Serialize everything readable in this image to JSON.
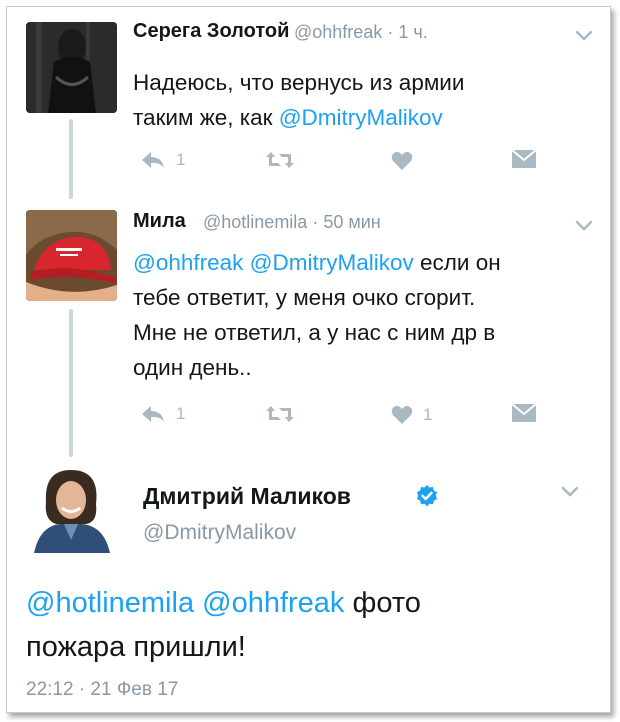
{
  "thread": [
    {
      "author_name": "Серега Золотой",
      "handle": "@ohhfreak",
      "separator": "·",
      "time": "1 ч.",
      "text_line1": "Надеюсь, что вернусь из армии",
      "text_line2_prefix": "таким же, как ",
      "text_line2_mention": "@DmitryMalikov",
      "reply_count": "1",
      "like_count": ""
    },
    {
      "author_name": "Мила",
      "handle": "@hotlinemila",
      "separator": "·",
      "time": "50 мин",
      "mention1": "@ohhfreak",
      "mention2": "@DmitryMalikov",
      "text_line1_rest": " если он",
      "text_line2": "тебе ответит, у меня очко сгорит.",
      "text_line3": "Мне не ответил, а у нас с ним др в",
      "text_line4": "один день..",
      "reply_count": "1",
      "like_count": "1"
    }
  ],
  "main_tweet": {
    "author_name": "Дмитрий Маликов",
    "handle": "@DmitryMalikov",
    "verified": true,
    "mention1": "@hotlinemila",
    "mention2": "@ohhfreak",
    "text_line1_rest": " фото",
    "text_line2": "пожара пришли!",
    "timestamp": "22:12 · 21 Фев 17"
  },
  "colors": {
    "link_blue": "#1da1f2",
    "meta_gray": "#8899a6",
    "icon_gray": "#aab8c2",
    "verified_blue": "#1da1f2"
  },
  "icons": [
    "reply-icon",
    "retweet-icon",
    "heart-icon",
    "direct-message-icon",
    "chevron-down-icon",
    "verified-badge-icon"
  ]
}
